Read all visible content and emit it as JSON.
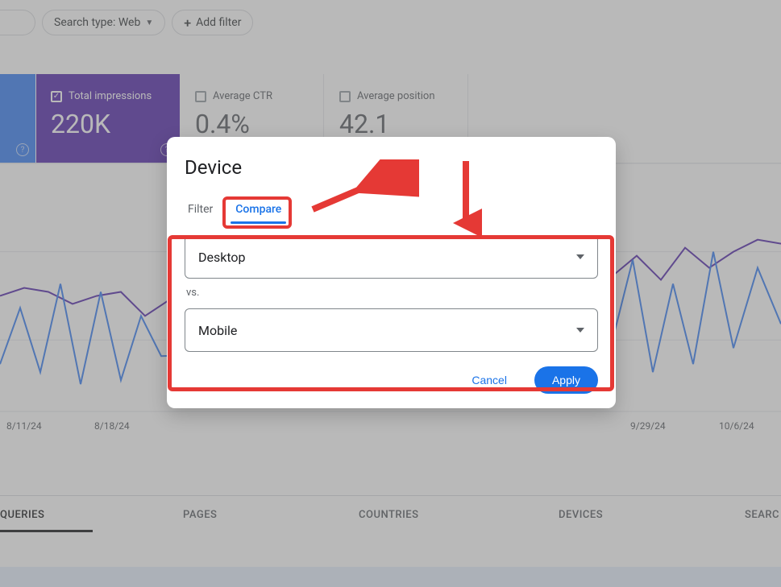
{
  "filters": {
    "search_type": "Search type: Web",
    "add_filter": "Add filter"
  },
  "metrics": {
    "impressions": {
      "label": "Total impressions",
      "value": "220K",
      "checked": true
    },
    "ctr": {
      "label": "Average CTR",
      "value": "0.4%",
      "checked": false
    },
    "position": {
      "label": "Average position",
      "value": "42.1",
      "checked": false
    }
  },
  "dates": [
    "8/11/24",
    "8/18/24",
    "9/29/24",
    "10/6/24"
  ],
  "tabs": {
    "queries": "QUERIES",
    "pages": "PAGES",
    "countries": "COUNTRIES",
    "devices": "DEVICES",
    "search": "SEARC"
  },
  "modal": {
    "title": "Device",
    "tab_filter": "Filter",
    "tab_compare": "Compare",
    "select1": "Desktop",
    "vs": "vs.",
    "select2": "Mobile",
    "cancel": "Cancel",
    "apply": "Apply"
  }
}
